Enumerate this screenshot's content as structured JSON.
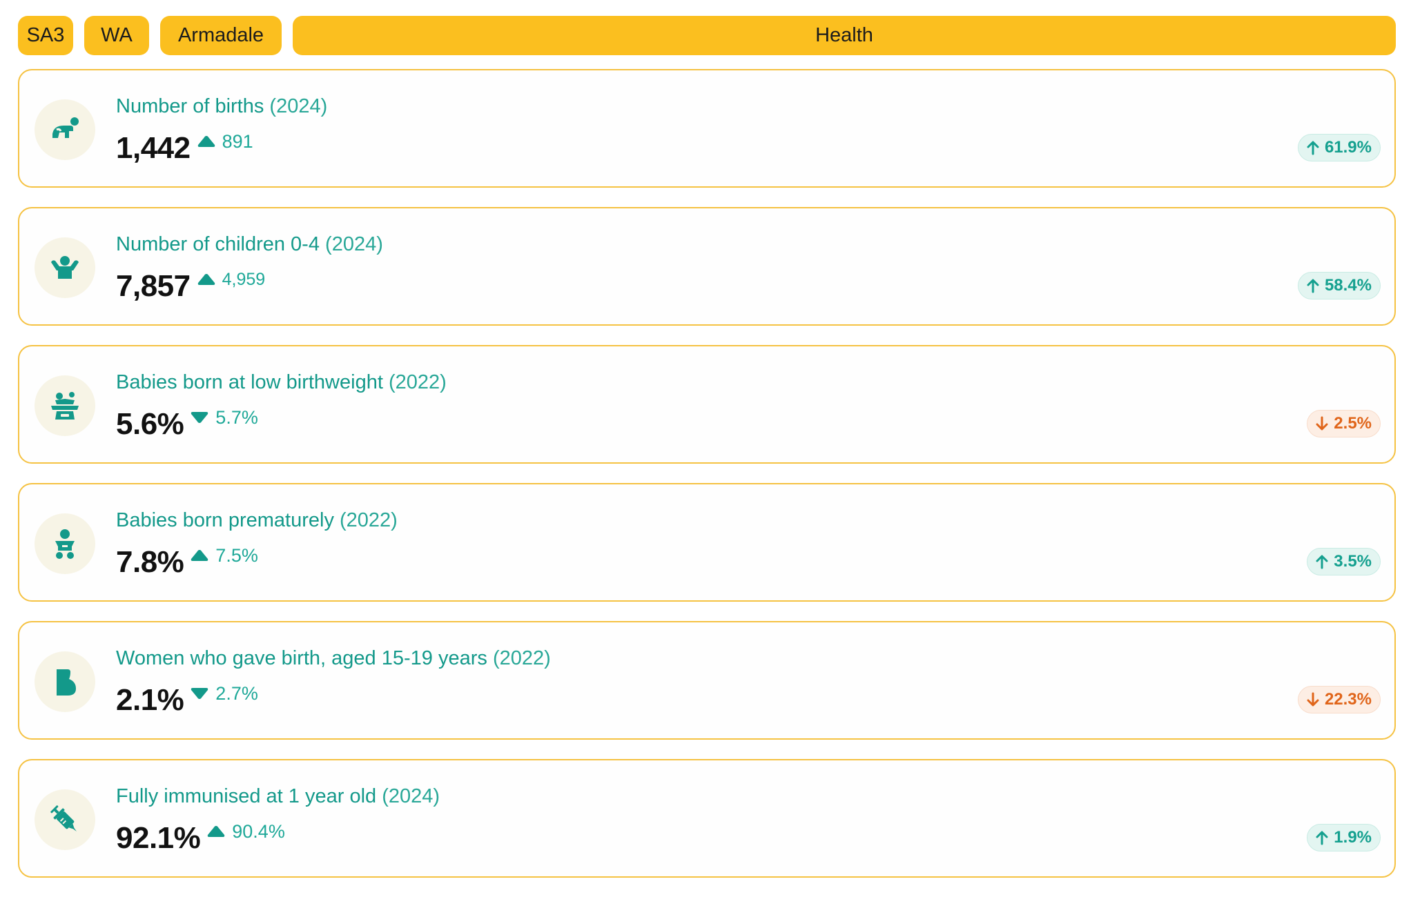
{
  "breadcrumbs": [
    "SA3",
    "WA",
    "Armadale",
    "Health"
  ],
  "colors": {
    "accent": "#fbbf1f",
    "teal": "#13998a",
    "up": "#15a08f",
    "down": "#e0651a",
    "card_border": "#f5c242"
  },
  "metrics": [
    {
      "icon": "crawling-baby-icon",
      "label": "Number of births",
      "year": "(2024)",
      "value": "1,442",
      "cmp_dir": "up",
      "cmp_value": "891",
      "change_dir": "up",
      "change": "61.9%"
    },
    {
      "icon": "child-arms-up-icon",
      "label": "Number of children 0-4",
      "year": "(2024)",
      "value": "7,857",
      "cmp_dir": "up",
      "cmp_value": "4,959",
      "change_dir": "up",
      "change": "58.4%"
    },
    {
      "icon": "baby-scale-icon",
      "label": "Babies born at low birthweight",
      "year": "(2022)",
      "value": "5.6%",
      "cmp_dir": "down",
      "cmp_value": "5.7%",
      "change_dir": "down",
      "change": "2.5%"
    },
    {
      "icon": "baby-icon",
      "label": "Babies born prematurely",
      "year": "(2022)",
      "value": "7.8%",
      "cmp_dir": "up",
      "cmp_value": "7.5%",
      "change_dir": "up",
      "change": "3.5%"
    },
    {
      "icon": "pregnant-belly-icon",
      "label": "Women who gave birth, aged 15-19 years",
      "year": "(2022)",
      "value": "2.1%",
      "cmp_dir": "down",
      "cmp_value": "2.7%",
      "change_dir": "down",
      "change": "22.3%"
    },
    {
      "icon": "syringe-icon",
      "label": "Fully immunised at 1 year old",
      "year": "(2024)",
      "value": "92.1%",
      "cmp_dir": "up",
      "cmp_value": "90.4%",
      "change_dir": "up",
      "change": "1.9%"
    }
  ]
}
